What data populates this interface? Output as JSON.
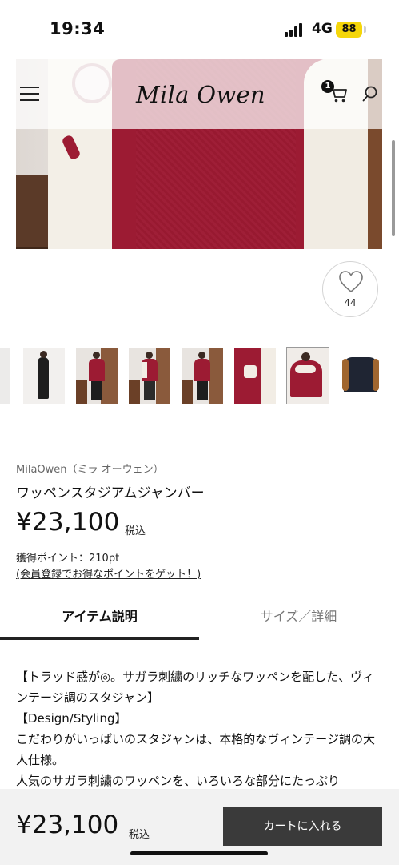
{
  "status_bar": {
    "time": "19:34",
    "network": "4G",
    "battery": "88"
  },
  "header": {
    "logo": "Mila Owen",
    "cart_count": "1",
    "icons": [
      "menu-icon",
      "cart-icon",
      "search-icon"
    ]
  },
  "favorite": {
    "count": "44"
  },
  "product": {
    "brand": "MilaOwen（ミラ オーウェン）",
    "name": "ワッペンスタジアムジャンバー",
    "price": "¥23,100",
    "tax_label": "税込",
    "points": "獲得ポイント：210pt",
    "points_link": "(会員登録でお得なポイントをゲット！)"
  },
  "tabs": [
    {
      "label": "アイテム説明",
      "active": true
    },
    {
      "label": "サイズ／詳細",
      "active": false
    }
  ],
  "description": {
    "lines": [
      "【トラッド感が◎。サガラ刺繍のリッチなワッペンを配した、ヴィンテージ調のスタジャン】",
      "【Design/Styling】",
      "こだわりがいっぱいのスタジャンは、本格的なヴィンテージ調の大人仕様。",
      "人気のサガラ刺繍のワッペンを、いろいろな部分にたっぷり"
    ]
  },
  "bottom_bar": {
    "price": "¥23,100",
    "tax_label": "税込",
    "add_to_cart": "カートに入れる"
  },
  "colors": {
    "accent_dark": "#3a3a3a",
    "battery": "#f5d60a",
    "jacket_red": "#9c1b33"
  }
}
